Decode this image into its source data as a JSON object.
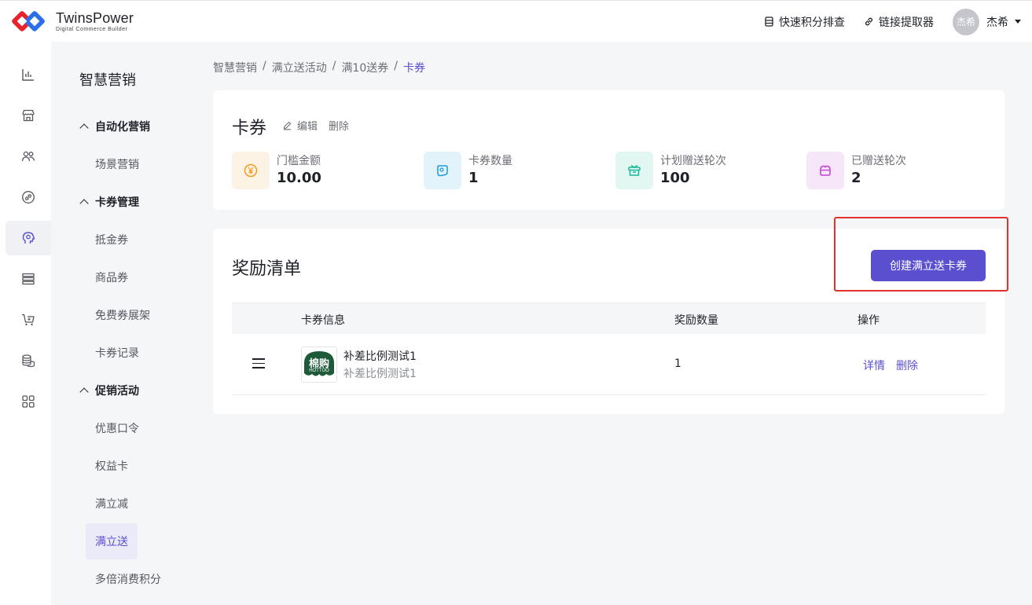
{
  "brand": {
    "name": "TwinsPower",
    "tagline": "Digital Commerce Builder"
  },
  "header": {
    "links": [
      {
        "label": "快速积分排查",
        "icon": "database-icon"
      },
      {
        "label": "链接提取器",
        "icon": "link-icon"
      }
    ],
    "user": {
      "avatar_text": "杰希",
      "name": "杰希"
    }
  },
  "rail": [
    {
      "icon": "chart-icon"
    },
    {
      "icon": "store-icon"
    },
    {
      "icon": "users-icon"
    },
    {
      "icon": "link-circle-icon"
    },
    {
      "icon": "brain-icon",
      "active": true
    },
    {
      "icon": "list-icon"
    },
    {
      "icon": "cart-icon"
    },
    {
      "icon": "coins-icon"
    },
    {
      "icon": "apps-icon"
    }
  ],
  "subnav": {
    "title": "智慧营销",
    "groups": [
      {
        "label": "自动化营销",
        "items": [
          "场景营销"
        ]
      },
      {
        "label": "卡券管理",
        "items": [
          "抵金券",
          "商品券",
          "免费券展架",
          "卡券记录"
        ]
      },
      {
        "label": "促销活动",
        "items": [
          "优惠口令",
          "权益卡",
          "满立减",
          "满立送",
          "多倍消费积分"
        ]
      }
    ],
    "active_item": "满立送"
  },
  "breadcrumb": [
    "智慧营销",
    "满立送活动",
    "满10送券",
    "卡券"
  ],
  "coupon_card": {
    "title": "卡券",
    "edit_label": "编辑",
    "delete_label": "删除",
    "stats": [
      {
        "label": "门槛金额",
        "value": "10.00",
        "icon": "yen-icon",
        "color": "#f59a23",
        "bg": "#fdf3e4"
      },
      {
        "label": "卡券数量",
        "value": "1",
        "icon": "ticket-icon",
        "color": "#1a9bd7",
        "bg": "#e3f3fb"
      },
      {
        "label": "计划赠送轮次",
        "value": "100",
        "icon": "gift-box-icon",
        "color": "#18b79b",
        "bg": "#e2f7f2"
      },
      {
        "label": "已赠送轮次",
        "value": "2",
        "icon": "bag-icon",
        "color": "#c43fd6",
        "bg": "#f7e6fa"
      }
    ]
  },
  "reward_card": {
    "title": "奖励清单",
    "create_button": "创建满立送卡券",
    "columns": [
      "卡券信息",
      "奖励数量",
      "操作"
    ],
    "rows": [
      {
        "name": "补差比例测试1",
        "sub": "补差比例测试1",
        "qty": "1",
        "thumb_text": "棉购",
        "thumb_sub": "HOTTOO",
        "actions": [
          "详情",
          "删除"
        ]
      }
    ]
  },
  "colors": {
    "primary": "#5a4fcf",
    "highlight": "#e2302c"
  }
}
